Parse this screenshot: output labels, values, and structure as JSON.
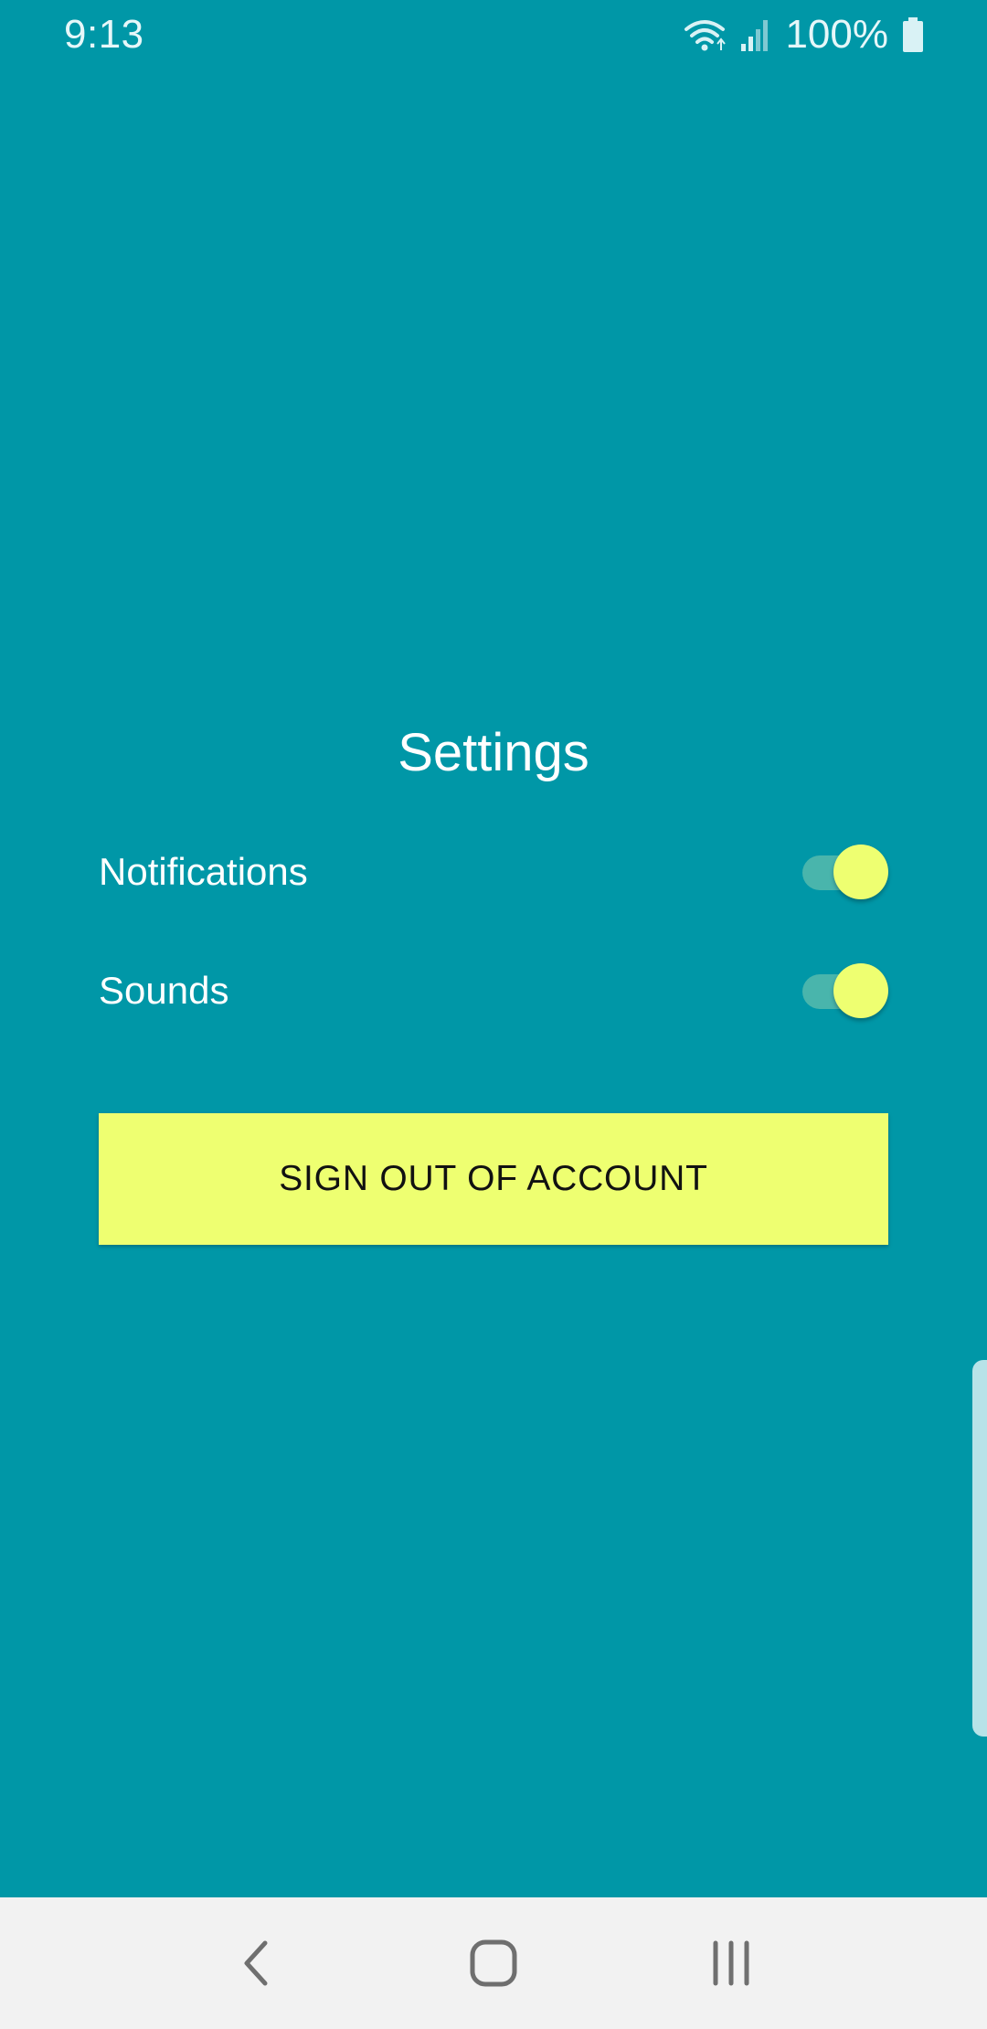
{
  "status_bar": {
    "time": "9:13",
    "battery_percent": "100%",
    "icons": [
      "wifi-icon",
      "signal-icon",
      "battery-icon"
    ]
  },
  "settings": {
    "title": "Settings",
    "items": [
      {
        "label": "Notifications",
        "enabled": true
      },
      {
        "label": "Sounds",
        "enabled": true
      }
    ],
    "sign_out_label": "SIGN OUT OF ACCOUNT"
  },
  "nav_bar": {
    "icons": [
      "back-icon",
      "home-icon",
      "recents-icon"
    ]
  },
  "colors": {
    "background": "#0097a7",
    "accent": "#eeff71",
    "toggle_track": "#4db6ac",
    "nav_bar": "#f2f2f2"
  }
}
